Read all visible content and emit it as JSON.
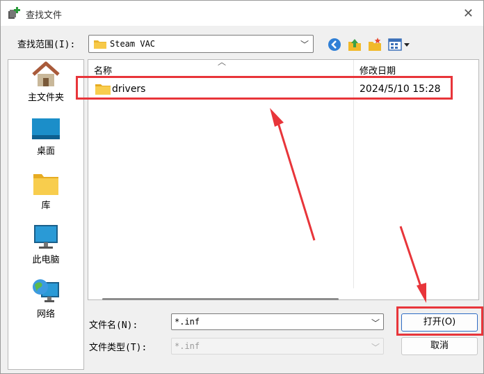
{
  "window": {
    "title": "查找文件",
    "close_symbol": "✕"
  },
  "lookin": {
    "label": "查找范围(I):",
    "value": "Steam VAC"
  },
  "places": [
    {
      "label": "主文件夹",
      "icon": "home-icon"
    },
    {
      "label": "桌面",
      "icon": "desktop-icon"
    },
    {
      "label": "库",
      "icon": "library-folder-icon"
    },
    {
      "label": "此电脑",
      "icon": "computer-icon"
    },
    {
      "label": "网络",
      "icon": "network-icon"
    }
  ],
  "list": {
    "columns": {
      "name": "名称",
      "modified": "修改日期"
    },
    "rows": [
      {
        "name": "drivers",
        "modified": "2024/5/10 15:28",
        "icon": "folder-icon"
      }
    ]
  },
  "filename": {
    "label": "文件名(N):",
    "value": "*.inf"
  },
  "filetype": {
    "label": "文件类型(T):",
    "value": "*.inf"
  },
  "buttons": {
    "open": "打开(O)",
    "cancel": "取消"
  },
  "annotation_color": "#e8353a"
}
